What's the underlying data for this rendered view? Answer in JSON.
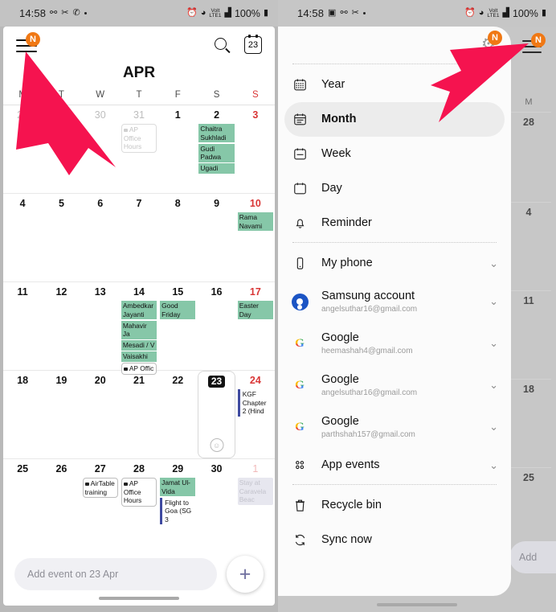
{
  "left": {
    "statusbar": {
      "time": "14:58",
      "battery": "100%",
      "network": "LTE1",
      "icons": [
        "bluetooth-icon",
        "scissors-icon",
        "whatsapp-icon",
        "dot-icon",
        "alarm-icon",
        "wifi-icon",
        "volte-icon",
        "signal-icon",
        "battery-icon"
      ]
    },
    "topbar": {
      "menu_badge": "N",
      "search_label": "Search",
      "today_label": "23"
    },
    "month_title": "APR",
    "dow": [
      "M",
      "T",
      "W",
      "T",
      "F",
      "S",
      "S"
    ],
    "add_event_placeholder": "Add event on 23 Apr",
    "fab_label": "+"
  },
  "right": {
    "statusbar": {
      "time": "14:58",
      "battery": "100%",
      "network": "LTE1"
    },
    "drawer": {
      "settings_badge": "N",
      "views": [
        {
          "label": "Year",
          "icon": "calendar-year-icon",
          "selected": false
        },
        {
          "label": "Month",
          "icon": "calendar-month-icon",
          "selected": true
        },
        {
          "label": "Week",
          "icon": "calendar-week-icon",
          "selected": false
        },
        {
          "label": "Day",
          "icon": "calendar-day-icon",
          "selected": false
        },
        {
          "label": "Reminder",
          "icon": "bell-icon",
          "selected": false
        }
      ],
      "accounts": [
        {
          "label": "My phone",
          "sub": "",
          "icon": "phone-icon",
          "chevron": true
        },
        {
          "label": "Samsung account",
          "sub": "angelsuthar16@gmail.com",
          "icon": "samsung-account-icon",
          "chevron": true
        },
        {
          "label": "Google",
          "sub": "heemashah4@gmail.com",
          "icon": "google-icon",
          "chevron": true
        },
        {
          "label": "Google",
          "sub": "angelsuthar16@gmail.com",
          "icon": "google-icon",
          "chevron": true
        },
        {
          "label": "Google",
          "sub": "parthshah157@gmail.com",
          "icon": "google-icon",
          "chevron": true
        },
        {
          "label": "App events",
          "sub": "",
          "icon": "apps-grid-icon",
          "chevron": true
        }
      ],
      "actions": [
        {
          "label": "Recycle bin",
          "icon": "trash-icon"
        },
        {
          "label": "Sync now",
          "icon": "sync-icon"
        }
      ]
    },
    "bg": {
      "menu_badge": "N",
      "dow": "M",
      "days": [
        "28",
        "4",
        "11",
        "18",
        "25"
      ],
      "add_partial": "Add"
    }
  },
  "calendar": {
    "weeks": [
      [
        {
          "num": "28",
          "other": true,
          "events": []
        },
        {
          "num": "29",
          "other": true,
          "events": []
        },
        {
          "num": "30",
          "other": true,
          "events": []
        },
        {
          "num": "31",
          "other": true,
          "events": [
            {
              "text": "AP Office Hours",
              "style": "outline ghost",
              "sq": true
            }
          ]
        },
        {
          "num": "1",
          "other": false,
          "events": []
        },
        {
          "num": "2",
          "other": false,
          "events": [
            {
              "text": "Chaitra Sukhladi",
              "style": "holiday"
            },
            {
              "text": "Gudi Padwa",
              "style": "holiday"
            },
            {
              "text": "Ugadi",
              "style": "holiday"
            }
          ]
        },
        {
          "num": "3",
          "other": false,
          "sun": true,
          "events": []
        }
      ],
      [
        {
          "num": "4",
          "other": false,
          "events": []
        },
        {
          "num": "5",
          "other": false,
          "events": []
        },
        {
          "num": "6",
          "other": false,
          "events": []
        },
        {
          "num": "7",
          "other": false,
          "events": []
        },
        {
          "num": "8",
          "other": false,
          "events": []
        },
        {
          "num": "9",
          "other": false,
          "events": []
        },
        {
          "num": "10",
          "other": false,
          "sun": true,
          "events": [
            {
              "text": "Rama Navami",
              "style": "holiday"
            }
          ]
        }
      ],
      [
        {
          "num": "11",
          "other": false,
          "events": []
        },
        {
          "num": "12",
          "other": false,
          "events": []
        },
        {
          "num": "13",
          "other": false,
          "events": []
        },
        {
          "num": "14",
          "other": false,
          "events": [
            {
              "text": "Ambedkar Jayanti",
              "style": "holiday"
            },
            {
              "text": "Mahavir Ja",
              "style": "holiday"
            },
            {
              "text": "Mesadi / V",
              "style": "holiday"
            },
            {
              "text": "Vaisakhi",
              "style": "holiday"
            },
            {
              "text": "AP Offic",
              "style": "outline",
              "sq": true
            }
          ]
        },
        {
          "num": "15",
          "other": false,
          "events": [
            {
              "text": "Good Friday",
              "style": "holiday"
            }
          ]
        },
        {
          "num": "16",
          "other": false,
          "events": []
        },
        {
          "num": "17",
          "other": false,
          "sun": true,
          "events": [
            {
              "text": "Easter Day",
              "style": "holiday"
            }
          ]
        }
      ],
      [
        {
          "num": "18",
          "other": false,
          "events": []
        },
        {
          "num": "19",
          "other": false,
          "events": []
        },
        {
          "num": "20",
          "other": false,
          "events": []
        },
        {
          "num": "21",
          "other": false,
          "events": []
        },
        {
          "num": "22",
          "other": false,
          "events": []
        },
        {
          "num": "23",
          "other": false,
          "today": true,
          "events": []
        },
        {
          "num": "24",
          "other": false,
          "sun": true,
          "events": [
            {
              "text": "KGF Chapter 2 (Hind",
              "style": "bar"
            }
          ]
        }
      ],
      [
        {
          "num": "25",
          "other": false,
          "events": []
        },
        {
          "num": "26",
          "other": false,
          "events": []
        },
        {
          "num": "27",
          "other": false,
          "events": [
            {
              "text": "AirTable training",
              "style": "outline",
              "sq": true
            }
          ]
        },
        {
          "num": "28",
          "other": false,
          "events": [
            {
              "text": "AP Office Hours",
              "style": "outline",
              "sq": true
            }
          ]
        },
        {
          "num": "29",
          "other": false,
          "events": [
            {
              "text": "Jamat Ul-Vida",
              "style": "holiday"
            },
            {
              "text": "Flight to Goa (SG 3",
              "style": "bar"
            }
          ]
        },
        {
          "num": "30",
          "other": false,
          "events": []
        },
        {
          "num": "1",
          "other": true,
          "sun": true,
          "events": [
            {
              "text": "Stay at Caravela Beac",
              "style": "mute"
            }
          ]
        }
      ]
    ]
  }
}
